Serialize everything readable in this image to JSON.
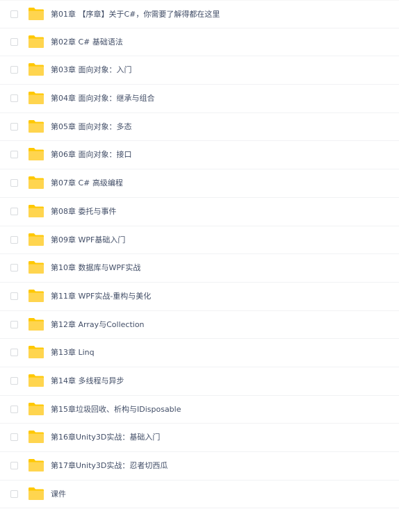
{
  "colors": {
    "folder_back": "#ffc800",
    "folder_front": "#ffd54f",
    "text": "#424e67",
    "divider": "#f1f2f4"
  },
  "items": [
    {
      "name": "第01章 【序章】关于C#，你需要了解得都在这里",
      "icon": "folder-icon"
    },
    {
      "name": "第02章 C# 基础语法",
      "icon": "folder-icon"
    },
    {
      "name": "第03章 面向对象：入门",
      "icon": "folder-icon"
    },
    {
      "name": "第04章 面向对象：继承与组合",
      "icon": "folder-icon"
    },
    {
      "name": "第05章 面向对象：多态",
      "icon": "folder-icon"
    },
    {
      "name": "第06章 面向对象：接口",
      "icon": "folder-icon"
    },
    {
      "name": "第07章 C# 高级编程",
      "icon": "folder-icon"
    },
    {
      "name": "第08章 委托与事件",
      "icon": "folder-icon"
    },
    {
      "name": "第09章 WPF基础入门",
      "icon": "folder-icon"
    },
    {
      "name": "第10章 数据库与WPF实战",
      "icon": "folder-icon"
    },
    {
      "name": "第11章 WPF实战-重构与美化",
      "icon": "folder-icon"
    },
    {
      "name": "第12章 Array与Collection",
      "icon": "folder-icon"
    },
    {
      "name": "第13章 Linq",
      "icon": "folder-icon"
    },
    {
      "name": "第14章 多线程与异步",
      "icon": "folder-icon"
    },
    {
      "name": "第15章垃圾回收、析构与IDisposable",
      "icon": "folder-icon"
    },
    {
      "name": "第16章Unity3D实战：基础入门",
      "icon": "folder-icon"
    },
    {
      "name": "第17章Unity3D实战：忍者切西瓜",
      "icon": "folder-icon"
    },
    {
      "name": "课件",
      "icon": "folder-icon"
    }
  ]
}
